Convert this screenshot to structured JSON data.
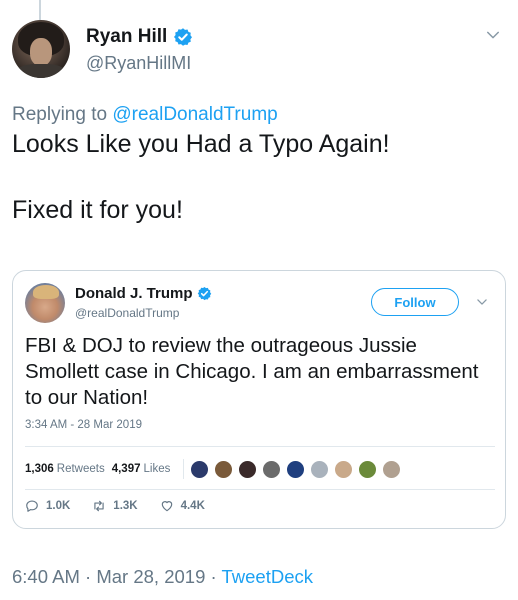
{
  "tweet": {
    "author": {
      "name": "Ryan Hill",
      "handle": "@RyanHillMI",
      "verified": true
    },
    "replying_prefix": "Replying to ",
    "replying_to": "@realDonaldTrump",
    "text_line1": "Looks Like you Had a Typo Again!",
    "text_line2": "Fixed it for you!",
    "time": "6:40 AM",
    "separator": "·",
    "date": "Mar 28, 2019",
    "source": "TweetDeck"
  },
  "quoted": {
    "author": {
      "name": "Donald J. Trump",
      "handle": "@realDonaldTrump",
      "verified": true
    },
    "follow_label": "Follow",
    "text": "FBI & DOJ to review the outrageous Jussie Smollett case in Chicago. I am an embarrassment to our Nation!",
    "timestamp": "3:34 AM - 28 Mar 2019",
    "retweets_count": "1,306",
    "retweets_label": "Retweets",
    "likes_count": "4,397",
    "likes_label": "Likes",
    "liker_colors": [
      "#2b3a6b",
      "#7a5a3a",
      "#3a2a2a",
      "#6b6b6b",
      "#1f3f7f",
      "#a9b2bc",
      "#c9a98a",
      "#6b8a3a",
      "#b0a090"
    ],
    "actions": {
      "replies": "1.0K",
      "retweets": "1.3K",
      "likes": "4.4K"
    }
  },
  "colors": {
    "accent": "#1da1f2",
    "muted": "#657786",
    "text": "#14171a",
    "border": "#ccd6dd"
  },
  "icons": [
    "verified-badge-icon",
    "chevron-down-icon",
    "reply-icon",
    "retweet-icon",
    "like-heart-icon"
  ]
}
